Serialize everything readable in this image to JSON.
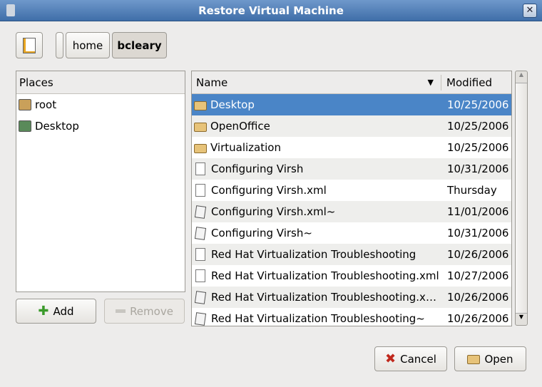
{
  "window": {
    "title": "Restore Virtual Machine"
  },
  "path": [
    "home",
    "bcleary"
  ],
  "places": {
    "header": "Places",
    "items": [
      {
        "label": "root",
        "icon": "home-folder-icon"
      },
      {
        "label": "Desktop",
        "icon": "desktop-icon"
      }
    ]
  },
  "files": {
    "columns": {
      "name": "Name",
      "modified": "Modified"
    },
    "rows": [
      {
        "name": "Desktop",
        "modified": "10/25/2006",
        "type": "folder"
      },
      {
        "name": "OpenOffice",
        "modified": "10/25/2006",
        "type": "folder"
      },
      {
        "name": "Virtualization",
        "modified": "10/25/2006",
        "type": "folder"
      },
      {
        "name": "Configuring Virsh",
        "modified": "10/31/2006",
        "type": "doc"
      },
      {
        "name": "Configuring Virsh.xml",
        "modified": "Thursday",
        "type": "doc"
      },
      {
        "name": "Configuring Virsh.xml~",
        "modified": "11/01/2006",
        "type": "bak"
      },
      {
        "name": "Configuring Virsh~",
        "modified": "10/31/2006",
        "type": "bak"
      },
      {
        "name": "Red Hat Virtualization Troubleshooting",
        "modified": "10/26/2006",
        "type": "doc"
      },
      {
        "name": "Red Hat Virtualization Troubleshooting.xml",
        "modified": "10/27/2006",
        "type": "doc"
      },
      {
        "name": "Red Hat Virtualization Troubleshooting.xml~",
        "modified": "10/26/2006",
        "type": "bak"
      },
      {
        "name": "Red Hat Virtualization Troubleshooting~",
        "modified": "10/26/2006",
        "type": "bak"
      }
    ]
  },
  "buttons": {
    "add": "Add",
    "remove": "Remove",
    "cancel": "Cancel",
    "open": "Open"
  }
}
